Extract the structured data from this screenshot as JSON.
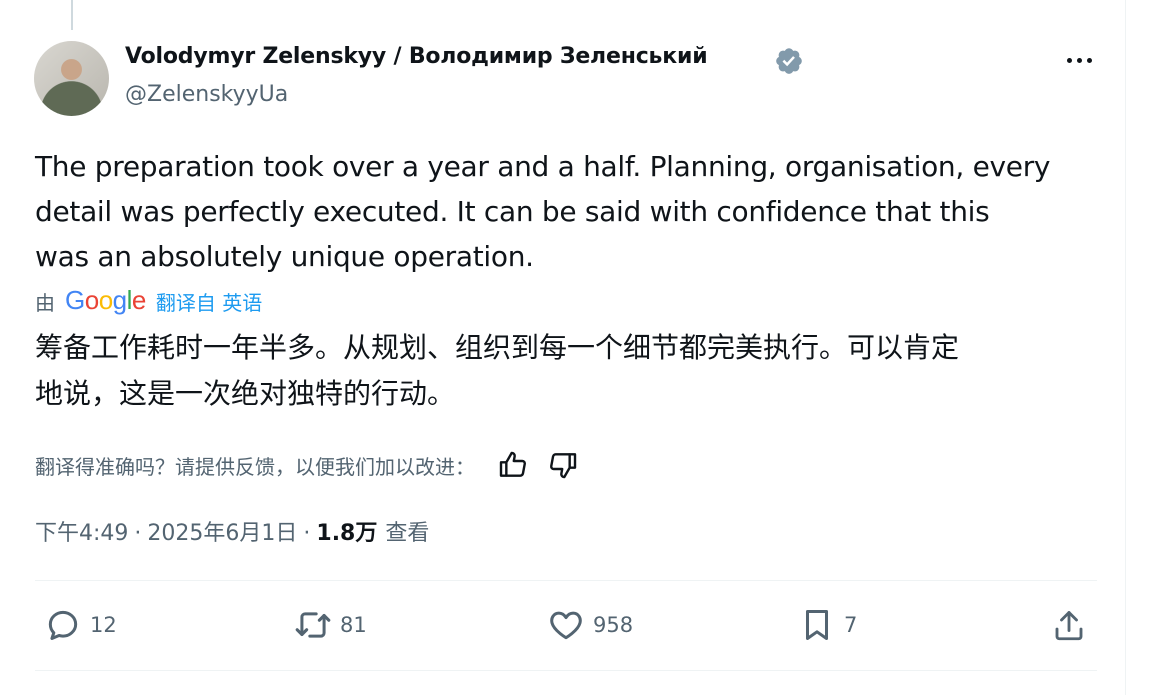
{
  "author": {
    "display_name": "Volodymyr Zelenskyy / Володимир Зеленський",
    "handle": "@ZelenskyyUa"
  },
  "tweet": {
    "lines": [
      "The preparation took over a year and a half. Planning, organisation, every",
      "detail was perfectly executed. It can be said with confidence that this",
      "was an absolutely unique operation."
    ]
  },
  "translation": {
    "by_label": "由",
    "google": [
      "G",
      "o",
      "o",
      "g",
      "l",
      "e"
    ],
    "translated_from": "翻译自 英语",
    "lines": [
      "筹备工作耗时一年半多。从规划、组织到每一个细节都完美执行。可以肯定",
      "地说，这是一次绝对独特的行动。"
    ],
    "feedback_prompt": "翻译得准确吗？请提供反馈，以便我们加以改进："
  },
  "meta": {
    "time": "下午4:49",
    "separator": "·",
    "date": "2025年6月1日",
    "views_count": "1.8万",
    "views_label": "查看"
  },
  "actions": {
    "replies": "12",
    "reposts": "81",
    "likes": "958",
    "bookmarks": "7"
  },
  "icons": {
    "verified": "verified-badge-icon",
    "more": "more-icon",
    "reply": "reply-icon",
    "repost": "repost-icon",
    "like": "heart-icon",
    "bookmark": "bookmark-icon",
    "share": "share-icon",
    "thumbs_up": "thumbs-up-icon",
    "thumbs_down": "thumbs-down-icon"
  },
  "colors": {
    "accent": "#1d9bf0",
    "secondary_text": "#536471",
    "verified": "#829aab"
  }
}
